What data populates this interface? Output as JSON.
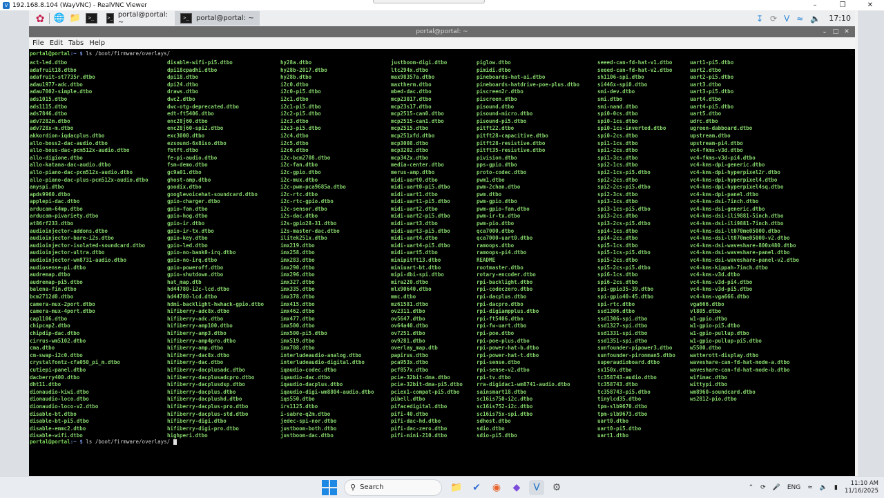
{
  "vnc": {
    "title": "192.168.8.104 (WayVNC) - RealVNC Viewer",
    "minimize": "–",
    "restore": "❐",
    "close": "✕"
  },
  "panel": {
    "tasks": [
      {
        "label": "portal@portal: ~"
      },
      {
        "label": "portal@portal: ~"
      }
    ],
    "clock": "17:10"
  },
  "terminal": {
    "title": "portal@portal: ~",
    "menu": [
      "File",
      "Edit",
      "Tabs",
      "Help"
    ],
    "prompt_user": "portal@portal",
    "prompt_path": ":~ $ ",
    "command": "ls /boot/firmware/overlays/",
    "columns": [
      [
        "act-led.dtbo",
        "adafruit18.dtbo",
        "adafruit-st7735r.dtbo",
        "adau1977-adc.dtbo",
        "adau7002-simple.dtbo",
        "ads1015.dtbo",
        "ads1115.dtbo",
        "ads7846.dtbo",
        "adv7282m.dtbo",
        "adv728x-m.dtbo",
        "akkordion-iqdacplus.dtbo",
        "allo-boss2-dac-audio.dtbo",
        "allo-boss-dac-pcm512x-audio.dtbo",
        "allo-digione.dtbo",
        "allo-katana-dac-audio.dtbo",
        "allo-piano-dac-pcm512x-audio.dtbo",
        "allo-piano-dac-plus-pcm512x-audio.dtbo",
        "anyspi.dtbo",
        "apds9960.dtbo",
        "applepi-dac.dtbo",
        "arducam-64mp.dtbo",
        "arducam-pivariety.dtbo",
        "at86rf233.dtbo",
        "audioinjector-addons.dtbo",
        "audioinjector-bare-i2s.dtbo",
        "audioinjector-isolated-soundcard.dtbo",
        "audioinjector-ultra.dtbo",
        "audioinjector-wm8731-audio.dtbo",
        "audiosense-pi.dtbo",
        "audremap.dtbo",
        "audremap-pi5.dtbo",
        "balena-fin.dtbo",
        "bcm2712d0.dtbo",
        "camera-mux-2port.dtbo",
        "camera-mux-4port.dtbo",
        "cap1106.dtbo",
        "chipcap2.dtbo",
        "chipdip-dac.dtbo",
        "cirrus-wm5102.dtbo",
        "cma.dtbo",
        "cm-swap-i2c0.dtbo",
        "crystalfontz-cfa050_pi_m.dtbo",
        "cutiepi-panel.dtbo",
        "dacberry400.dtbo",
        "dht11.dtbo",
        "dionaudio-kiwi.dtbo",
        "dionaudio-loco.dtbo",
        "dionaudio-loco-v2.dtbo",
        "disable-bt.dtbo",
        "disable-bt-pi5.dtbo",
        "disable-emmc2.dtbo",
        "disable-wifi.dtbo"
      ],
      [
        "disable-wifi-pi5.dtbo",
        "dpi18cpadhi.dtbo",
        "dpi18.dtbo",
        "dpi24.dtbo",
        "draws.dtbo",
        "dwc2.dtbo",
        "dwc-otg-deprecated.dtbo",
        "edt-ft5406.dtbo",
        "enc28j60.dtbo",
        "enc28j60-spi2.dtbo",
        "exc3000.dtbo",
        "ezsound-6x8iso.dtbo",
        "fbtft.dtbo",
        "fe-pi-audio.dtbo",
        "fsm-demo.dtbo",
        "gc9a01.dtbo",
        "ghost-amp.dtbo",
        "goodix.dtbo",
        "googlevoicehat-soundcard.dtbo",
        "gpio-charger.dtbo",
        "gpio-fan.dtbo",
        "gpio-hog.dtbo",
        "gpio-ir.dtbo",
        "gpio-ir-tx.dtbo",
        "gpio-key.dtbo",
        "gpio-led.dtbo",
        "gpio-no-bank0-irq.dtbo",
        "gpio-no-irq.dtbo",
        "gpio-poweroff.dtbo",
        "gpio-shutdown.dtbo",
        "hat_map.dtb",
        "hd44780-i2c-lcd.dtbo",
        "hd44780-lcd.dtbo",
        "hdmi-backlight-hwhack-gpio.dtbo",
        "hifiberry-adc8x.dtbo",
        "hifiberry-adc.dtbo",
        "hifiberry-amp100.dtbo",
        "hifiberry-amp3.dtbo",
        "hifiberry-amp4pro.dtbo",
        "hifiberry-amp.dtbo",
        "hifiberry-dac8x.dtbo",
        "hifiberry-dac.dtbo",
        "hifiberry-dacplusadc.dtbo",
        "hifiberry-dacplusadcpro.dtbo",
        "hifiberry-dacplusdsp.dtbo",
        "hifiberry-dacplus.dtbo",
        "hifiberry-dacplushd.dtbo",
        "hifiberry-dacplus-pro.dtbo",
        "hifiberry-dacplus-std.dtbo",
        "hifiberry-digi.dtbo",
        "hifiberry-digi-pro.dtbo",
        "highperi.dtbo"
      ],
      [
        "hy28a.dtbo",
        "hy28b-2017.dtbo",
        "hy28b.dtbo",
        "i2c0.dtbo",
        "i2c0-pi5.dtbo",
        "i2c1.dtbo",
        "i2c1-pi5.dtbo",
        "i2c2-pi5.dtbo",
        "i2c3.dtbo",
        "i2c3-pi5.dtbo",
        "i2c4.dtbo",
        "i2c5.dtbo",
        "i2c6.dtbo",
        "i2c-bcm2708.dtbo",
        "i2c-fan.dtbo",
        "i2c-gpio.dtbo",
        "i2c-mux.dtbo",
        "i2c-pwm-pca9685a.dtbo",
        "i2c-rtc.dtbo",
        "i2c-rtc-gpio.dtbo",
        "i2c-sensor.dtbo",
        "i2s-dac.dtbo",
        "i2s-gpio28-31.dtbo",
        "i2s-master-dac.dtbo",
        "ilitek251x.dtbo",
        "imx219.dtbo",
        "imx258.dtbo",
        "imx283.dtbo",
        "imx290.dtbo",
        "imx296.dtbo",
        "imx327.dtbo",
        "imx335.dtbo",
        "imx378.dtbo",
        "imx415.dtbo",
        "imx462.dtbo",
        "imx477.dtbo",
        "imx500.dtbo",
        "imx500-pi5.dtbo",
        "imx519.dtbo",
        "imx708.dtbo",
        "interludeaudio-analog.dtbo",
        "interludeaudio-digital.dtbo",
        "iqaudio-codec.dtbo",
        "iqaudio-dac.dtbo",
        "iqaudio-dacplus.dtbo",
        "iqaudio-digi-wm8804-audio.dtbo",
        "iqs550.dtbo",
        "irs1125.dtbo",
        "i-sabre-q2m.dtbo",
        "jedec-spi-nor.dtbo",
        "justboom-both.dtbo",
        "justboom-dac.dtbo"
      ],
      [
        "justboom-digi.dtbo",
        "ltc294x.dtbo",
        "max98357a.dtbo",
        "maxtherm.dtbo",
        "mbed-dac.dtbo",
        "mcp23017.dtbo",
        "mcp23s17.dtbo",
        "mcp2515-can0.dtbo",
        "mcp2515-can1.dtbo",
        "mcp2515.dtbo",
        "mcp251xfd.dtbo",
        "mcp3008.dtbo",
        "mcp3202.dtbo",
        "mcp342x.dtbo",
        "media-center.dtbo",
        "merus-amp.dtbo",
        "midi-uart0.dtbo",
        "midi-uart0-pi5.dtbo",
        "midi-uart1.dtbo",
        "midi-uart1-pi5.dtbo",
        "midi-uart2.dtbo",
        "midi-uart2-pi5.dtbo",
        "midi-uart3.dtbo",
        "midi-uart3-pi5.dtbo",
        "midi-uart4.dtbo",
        "midi-uart4-pi5.dtbo",
        "midi-uart5.dtbo",
        "minipitft13.dtbo",
        "miniuart-bt.dtbo",
        "mipi-dbi-spi.dtbo",
        "mira220.dtbo",
        "mlx90640.dtbo",
        "mmc.dtbo",
        "mz61581.dtbo",
        "ov2311.dtbo",
        "ov5647.dtbo",
        "ov64a40.dtbo",
        "ov7251.dtbo",
        "ov9281.dtbo",
        "overlay_map.dtb",
        "papirus.dtbo",
        "pca953x.dtbo",
        "pcf857x.dtbo",
        "pcie-32bit-dma.dtbo",
        "pcie-32bit-dma-pi5.dtbo",
        "pciex1-compat-pi5.dtbo",
        "pibell.dtbo",
        "pifacedigital.dtbo",
        "pifi-40.dtbo",
        "pifi-dac-hd.dtbo",
        "pifi-dac-zero.dtbo",
        "pifi-mini-210.dtbo"
      ],
      [
        "piglow.dtbo",
        "pimidi.dtbo",
        "pineboards-hat-ai.dtbo",
        "pineboards-hatdrive-poe-plus.dtbo",
        "piscreen2r.dtbo",
        "piscreen.dtbo",
        "pisound.dtbo",
        "pisound-micro.dtbo",
        "pisound-pi5.dtbo",
        "pitft22.dtbo",
        "pitft28-capacitive.dtbo",
        "pitft28-resistive.dtbo",
        "pitft35-resistive.dtbo",
        "pivision.dtbo",
        "pps-gpio.dtbo",
        "proto-codec.dtbo",
        "pwm1.dtbo",
        "pwm-2chan.dtbo",
        "pwm.dtbo",
        "pwm-gpio.dtbo",
        "pwm-gpio-fan.dtbo",
        "pwm-ir-tx.dtbo",
        "pwm-pio.dtbo",
        "qca7000.dtbo",
        "qca7000-uart0.dtbo",
        "ramoops.dtbo",
        "ramoops-pi4.dtbo",
        "README",
        "rootmaster.dtbo",
        "rotary-encoder.dtbo",
        "rpi-backlight.dtbo",
        "rpi-codeczero.dtbo",
        "rpi-dacplus.dtbo",
        "rpi-dacpro.dtbo",
        "rpi-digiampplus.dtbo",
        "rpi-ft5406.dtbo",
        "rpi-fw-uart.dtbo",
        "rpi-poe.dtbo",
        "rpi-poe-plus.dtbo",
        "rpi-power-hat-b.dtbo",
        "rpi-power-hat-t.dtbo",
        "rpi-sense.dtbo",
        "rpi-sense-v2.dtbo",
        "rpi-tv.dtbo",
        "rra-digidac1-wm8741-audio.dtbo",
        "sainsmart18.dtbo",
        "sc16is750-i2c.dtbo",
        "sc16is752-i2c.dtbo",
        "sc16is75x-spi.dtbo",
        "sdhost.dtbo",
        "sdio.dtbo",
        "sdio-pi5.dtbo"
      ],
      [
        "seeed-can-fd-hat-v1.dtbo",
        "seeed-can-fd-hat-v2.dtbo",
        "sh1106-spi.dtbo",
        "si446x-spi0.dtbo",
        "smi-dev.dtbo",
        "smi.dtbo",
        "smi-nand.dtbo",
        "spi0-0cs.dtbo",
        "spi0-1cs.dtbo",
        "spi0-1cs-inverted.dtbo",
        "spi0-2cs.dtbo",
        "spi1-1cs.dtbo",
        "spi1-2cs.dtbo",
        "spi1-3cs.dtbo",
        "spi2-1cs.dtbo",
        "spi2-1cs-pi5.dtbo",
        "spi2-2cs.dtbo",
        "spi2-2cs-pi5.dtbo",
        "spi2-3cs.dtbo",
        "spi3-1cs.dtbo",
        "spi3-1cs-pi5.dtbo",
        "spi3-2cs.dtbo",
        "spi3-2cs-pi5.dtbo",
        "spi4-1cs.dtbo",
        "spi4-2cs.dtbo",
        "spi5-1cs.dtbo",
        "spi5-1cs-pi5.dtbo",
        "spi5-2cs.dtbo",
        "spi5-2cs-pi5.dtbo",
        "spi6-1cs.dtbo",
        "spi6-2cs.dtbo",
        "spi-gpio35-39.dtbo",
        "spi-gpio40-45.dtbo",
        "spi-rtc.dtbo",
        "ssd1306.dtbo",
        "ssd1306-spi.dtbo",
        "ssd1327-spi.dtbo",
        "ssd1331-spi.dtbo",
        "ssd1351-spi.dtbo",
        "sunfounder-pipower3.dtbo",
        "sunfounder-pironman5.dtbo",
        "superaudioboard.dtbo",
        "sx150x.dtbo",
        "tc358743-audio.dtbo",
        "tc358743.dtbo",
        "tc358743-pi5.dtbo",
        "tinylcd35.dtbo",
        "tpm-slb9670.dtbo",
        "tpm-slb9673.dtbo",
        "uart0.dtbo",
        "uart0-pi5.dtbo",
        "uart1.dtbo"
      ],
      [
        "uart1-pi5.dtbo",
        "uart2.dtbo",
        "uart2-pi5.dtbo",
        "uart3.dtbo",
        "uart3-pi5.dtbo",
        "uart4.dtbo",
        "uart4-pi5.dtbo",
        "uart5.dtbo",
        "udrc.dtbo",
        "ugreen-dabboard.dtbo",
        "upstream.dtbo",
        "upstream-pi4.dtbo",
        "vc4-fkms-v3d.dtbo",
        "vc4-fkms-v3d-pi4.dtbo",
        "vc4-kms-dpi-generic.dtbo",
        "vc4-kms-dpi-hyperpixel2r.dtbo",
        "vc4-kms-dpi-hyperpixel4.dtbo",
        "vc4-kms-dpi-hyperpixel4sq.dtbo",
        "vc4-kms-dpi-panel.dtbo",
        "vc4-kms-dsi-7inch.dtbo",
        "vc4-kms-dsi-generic.dtbo",
        "vc4-kms-dsi-ili9881-5inch.dtbo",
        "vc4-kms-dsi-ili9881-7inch.dtbo",
        "vc4-kms-dsi-lt070me05000.dtbo",
        "vc4-kms-dsi-lt070me05000-v2.dtbo",
        "vc4-kms-dsi-waveshare-800x480.dtbo",
        "vc4-kms-dsi-waveshare-panel.dtbo",
        "vc4-kms-dsi-waveshare-panel-v2.dtbo",
        "vc4-kms-kippah-7inch.dtbo",
        "vc4-kms-v3d.dtbo",
        "vc4-kms-v3d-pi4.dtbo",
        "vc4-kms-v3d-pi5.dtbo",
        "vc4-kms-vga666.dtbo",
        "vga666.dtbo",
        "vl805.dtbo",
        "w1-gpio.dtbo",
        "w1-gpio-pi5.dtbo",
        "w1-gpio-pullup.dtbo",
        "w1-gpio-pullup-pi5.dtbo",
        "w5500.dtbo",
        "watterott-display.dtbo",
        "waveshare-can-fd-hat-mode-a.dtbo",
        "waveshare-can-fd-hat-mode-b.dtbo",
        "wifimac.dtbo",
        "wittypi.dtbo",
        "wm8960-soundcard.dtbo",
        "ws2812-pio.dtbo"
      ]
    ]
  },
  "taskbar": {
    "search_label": "Search",
    "lang": "ENG",
    "time": "11:10 AM",
    "date": "11/16/2025"
  },
  "colors": {
    "terminal_text": "#85d56b",
    "prompt_path": "#6d8bd6",
    "accent": "#1e88e5"
  }
}
